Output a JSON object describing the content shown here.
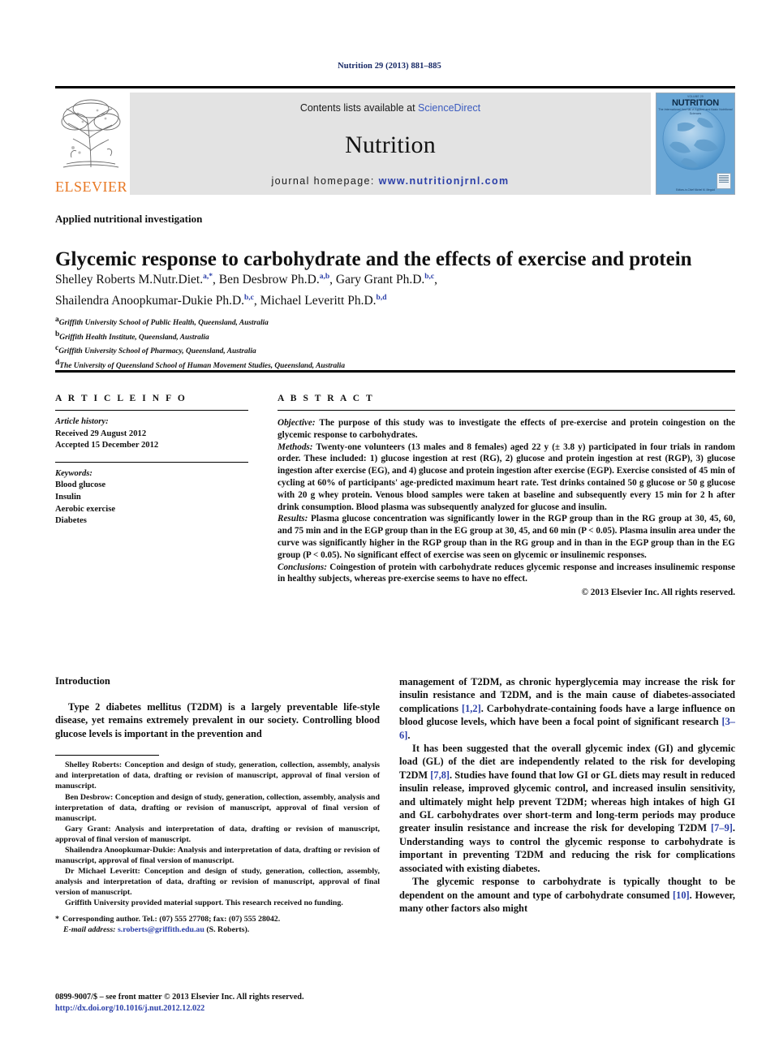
{
  "running_head": "Nutrition 29 (2013) 881–885",
  "masthead": {
    "publisher_name": "ELSEVIER",
    "contents_prefix": "Contents lists available at ",
    "contents_link": "ScienceDirect",
    "journal_name": "Nutrition",
    "homepage_prefix": "journal homepage: ",
    "homepage_url": "www.nutritionjrnl.com",
    "cover": {
      "top_tiny": "VOLUME 29",
      "title": "NUTRITION",
      "subtitle": "The International Journal of Applied and Basic Nutritional Sciences",
      "bottom": "Editors-in-Chief   Michel M. Meguid"
    },
    "link_color": "#2b3fa8",
    "elsevier_color": "#E87722"
  },
  "article": {
    "section_type": "Applied nutritional investigation",
    "title": "Glycemic response to carbohydrate and the effects of exercise and protein",
    "authors": [
      {
        "name": "Shelley Roberts M.Nutr.Diet.",
        "sup": "a,*",
        "sep": ", "
      },
      {
        "name": "Ben Desbrow Ph.D.",
        "sup": "a,b",
        "sep": ", "
      },
      {
        "name": "Gary Grant Ph.D.",
        "sup": "b,c",
        "sep": ","
      },
      {
        "name": "Shailendra Anoopkumar-Dukie Ph.D.",
        "sup": "b,c",
        "sep": ", "
      },
      {
        "name": "Michael Leveritt Ph.D.",
        "sup": "b,d",
        "sep": ""
      }
    ],
    "affiliations": [
      {
        "mark": "a",
        "text": "Griffith University School of Public Health, Queensland, Australia"
      },
      {
        "mark": "b",
        "text": "Griffith Health Institute, Queensland, Australia"
      },
      {
        "mark": "c",
        "text": "Griffith University School of Pharmacy, Queensland, Australia"
      },
      {
        "mark": "d",
        "text": "The University of Queensland School of Human Movement Studies, Queensland, Australia"
      }
    ]
  },
  "info": {
    "heading": "A R T I C L E   I N F O",
    "history_label": "Article history:",
    "received": "Received 29 August 2012",
    "accepted": "Accepted 15 December 2012",
    "keywords_label": "Keywords:",
    "keywords": [
      "Blood glucose",
      "Insulin",
      "Aerobic exercise",
      "Diabetes"
    ]
  },
  "abstract": {
    "heading": "A B S T R A C T",
    "objective_label": "Objective:",
    "objective_text": " The purpose of this study was to investigate the effects of pre-exercise and protein coingestion on the glycemic response to carbohydrates.",
    "methods_label": "Methods:",
    "methods_text": " Twenty-one volunteers (13 males and 8 females) aged 22 y (± 3.8 y) participated in four trials in random order. These included: 1) glucose ingestion at rest (RG), 2) glucose and protein ingestion at rest (RGP), 3) glucose ingestion after exercise (EG), and 4) glucose and protein ingestion after exercise (EGP). Exercise consisted of 45 min of cycling at 60% of participants' age-predicted maximum heart rate. Test drinks contained 50 g glucose or 50 g glucose with 20 g whey protein. Venous blood samples were taken at baseline and subsequently every 15 min for 2 h after drink consumption. Blood plasma was subsequently analyzed for glucose and insulin.",
    "results_label": "Results:",
    "results_text": " Plasma glucose concentration was significantly lower in the RGP group than in the RG group at 30, 45, 60, and 75 min and in the EGP group than in the EG group at 30, 45, and 60 min (P < 0.05). Plasma insulin area under the curve was significantly higher in the RGP group than in the RG group and in than in the EGP group than in the EG group (P < 0.05). No significant effect of exercise was seen on glycemic or insulinemic responses.",
    "conclusions_label": "Conclusions:",
    "conclusions_text": " Coingestion of protein with carbohydrate reduces glycemic response and increases insulinemic response in healthy subjects, whereas pre-exercise seems to have no effect.",
    "copyright": "© 2013 Elsevier Inc. All rights reserved."
  },
  "introduction": {
    "heading": "Introduction",
    "left_para_1": "Type 2 diabetes mellitus (T2DM) is a largely preventable life-style disease, yet remains extremely prevalent in our society. Controlling blood glucose levels is important in the prevention and",
    "right_para_1_a": "management of T2DM, as chronic hyperglycemia may increase the risk for insulin resistance and T2DM, and is the main cause of diabetes-associated complications ",
    "right_para_1_ref1": "[1,2]",
    "right_para_1_b": ". Carbohydrate-containing foods have a large influence on blood glucose levels, which have been a focal point of significant research ",
    "right_para_1_ref2": "[3–6]",
    "right_para_1_c": ".",
    "right_para_2_a": "It has been suggested that the overall glycemic index (GI) and glycemic load (GL) of the diet are independently related to the risk for developing T2DM ",
    "right_para_2_ref1": "[7,8]",
    "right_para_2_b": ". Studies have found that low GI or GL diets may result in reduced insulin release, improved glycemic control, and increased insulin sensitivity, and ultimately might help prevent T2DM; whereas high intakes of high GI and GL carbohydrates over short-term and long-term periods may produce greater insulin resistance and increase the risk for developing T2DM ",
    "right_para_2_ref2": "[7–9]",
    "right_para_2_c": ". Understanding ways to control the glycemic response to carbohydrate is important in preventing T2DM and reducing the risk for complications associated with existing diabetes.",
    "right_para_3_a": "The glycemic response to carbohydrate is typically thought to be dependent on the amount and type of carbohydrate consumed ",
    "right_para_3_ref1": "[10]",
    "right_para_3_b": ". However, many other factors also might"
  },
  "notes": {
    "contributions": [
      "Shelley Roberts: Conception and design of study, generation, collection, assembly, analysis and interpretation of data, drafting or revision of manuscript, approval of final version of manuscript.",
      "Ben Desbrow: Conception and design of study, generation, collection, assembly, analysis and interpretation of data, drafting or revision of manuscript, approval of final version of manuscript.",
      "Gary Grant: Analysis and interpretation of data, drafting or revision of manuscript, approval of final version of manuscript.",
      "Shailendra Anoopkumar-Dukie: Analysis and interpretation of data, drafting or revision of manuscript, approval of final version of manuscript.",
      "Dr Michael Leveritt: Conception and design of study, generation, collection, assembly, analysis and interpretation of data, drafting or revision of manuscript, approval of final version of manuscript.",
      "Griffith University provided material support. This research received no funding."
    ],
    "corresponding_star": "*",
    "corresponding": "Corresponding author. Tel.: (07) 555 27708; fax: (07) 555 28042.",
    "email_label": "E-mail address:",
    "email": "s.roberts@griffith.edu.au",
    "email_owner": " (S. Roberts)."
  },
  "footer": {
    "issn_line": "0899-9007/$ – see front matter © 2013 Elsevier Inc. All rights reserved.",
    "doi": "http://dx.doi.org/10.1016/j.nut.2012.12.022"
  }
}
